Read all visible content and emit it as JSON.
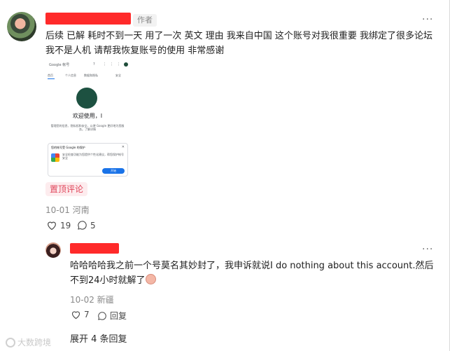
{
  "comment": {
    "author_badge": "作者",
    "more_label": "···",
    "text": "后续 已解 耗时不到一天 用了一次 英文 理由 我来自中国 这个账号对我很重要 我绑定了很多论坛 我不是人机 请帮我恢复账号的使用 非常感谢",
    "pin_label": "置顶评论",
    "meta": "10-01 河南",
    "likes": "19",
    "comments": "5",
    "screenshot": {
      "app_title": "Google 帐号",
      "header_icons": "? ⋮⋮⋮",
      "tabs": [
        "首页",
        "个人信息",
        "数据和隐私",
        "安全"
      ],
      "welcome": "欢迎使用，I",
      "desc": "管理您的信息、隐私权和安全，以便 Google 更好地为您服务。了解详情",
      "card_title": "您的帐号受 Google 的保护",
      "card_close": "✕",
      "card_text": "安全检查功能为您提供个性化建议，帮您保护帐号安全",
      "card_button": "开始"
    }
  },
  "reply": {
    "more_label": "···",
    "text": "哈哈哈哈我之前一个号莫名其妙封了，我申诉就说I do nothing about this account.然后不到24小时就解了",
    "meta": "10-02 新疆",
    "likes": "7",
    "reply_label": "回复"
  },
  "expand_label": "展开 4 条回复",
  "watermark": "大数跨境"
}
